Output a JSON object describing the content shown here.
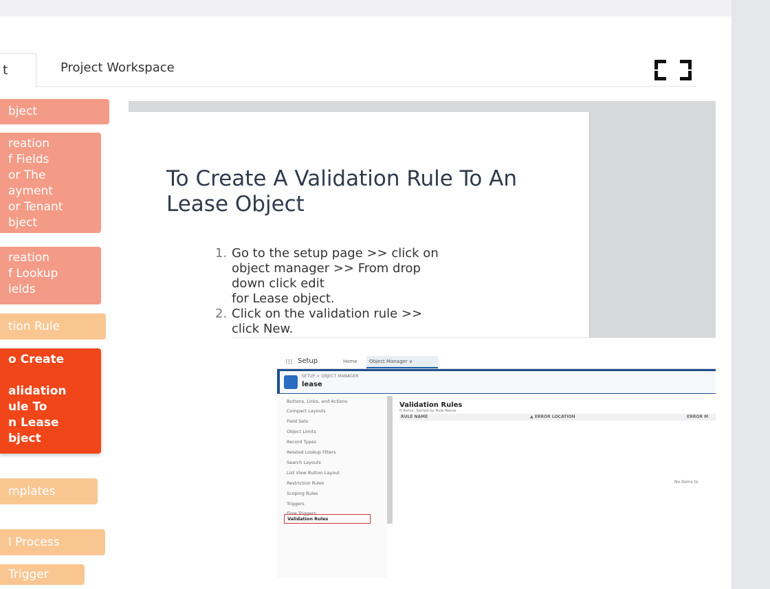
{
  "tabs": {
    "prev_tab_label": "t",
    "active_tab_label": "Project Workspace"
  },
  "nav": {
    "items": [
      {
        "label": "bject",
        "style": "salmon"
      },
      {
        "label": "reation\nf Fields\nor The\nayment\nor Tenant\nbject",
        "style": "salmon"
      },
      {
        "label": "reation\nf Lookup\nields",
        "style": "salmon"
      },
      {
        "label": "tion Rule",
        "style": "peach"
      },
      {
        "label": "o Create\n\nalidation\nule To\nn Lease\nbject",
        "style": "active"
      },
      {
        "label": "mplates",
        "style": "peach"
      },
      {
        "label": "l Process",
        "style": "peach"
      },
      {
        "label": "Trigger",
        "style": "peach"
      }
    ]
  },
  "slide": {
    "title": "To Create A Validation Rule To An Lease Object",
    "steps": [
      {
        "num": "1.",
        "text": "Go to the setup page >> click on\nobject manager >> From drop\ndown click edit\nfor  Lease object."
      },
      {
        "num": "2.",
        "text": "Click on the validation rule >>\nclick New."
      }
    ]
  },
  "screenshot": {
    "app_launcher": "⁝⁝⁝",
    "setup_label": "Setup",
    "home_tab": "Home",
    "object_manager_tab": "Object Manager  ∨",
    "breadcrumb": "SETUP > OBJECT MANAGER",
    "object_name": "lease",
    "sidebar_items": [
      "Buttons, Links, and Actions",
      "Compact Layouts",
      "Field Sets",
      "Object Limits",
      "Record Types",
      "Related Lookup Filters",
      "Search Layouts",
      "List View Button Layout",
      "Restriction Rules",
      "Scoping Rules",
      "Triggers",
      "Flow Triggers"
    ],
    "selected_item": "Validation Rules",
    "main_title": "Validation Rules",
    "main_subtitle": "0 Items, Sorted by Rule Name",
    "columns": [
      "RULE NAME",
      "▲  ERROR LOCATION",
      "ERROR M"
    ],
    "empty_text": "No items to"
  }
}
